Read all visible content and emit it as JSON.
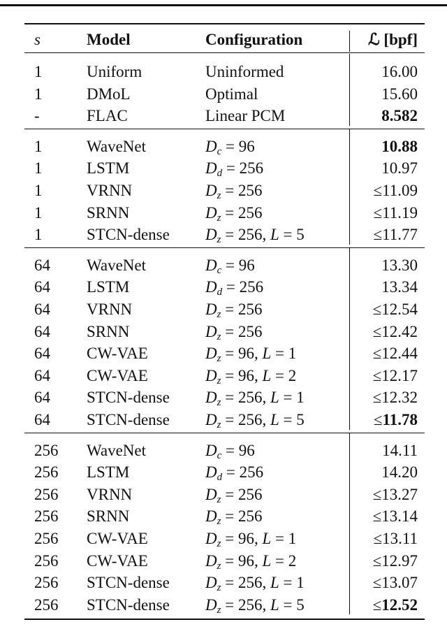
{
  "header": {
    "s": "s",
    "model": "Model",
    "configuration": "Configuration",
    "loss": "ℒ [bpf]"
  },
  "groups": [
    [
      {
        "s": "1",
        "model": "Uniform",
        "config": {
          "text": "Uninformed"
        },
        "value": {
          "prefix": "",
          "number": "16.00",
          "bold": false
        }
      },
      {
        "s": "1",
        "model": "DMoL",
        "config": {
          "text": "Optimal"
        },
        "value": {
          "prefix": "",
          "number": "15.60",
          "bold": false
        }
      },
      {
        "s": "-",
        "model": "FLAC",
        "config": {
          "text": "Linear PCM"
        },
        "value": {
          "prefix": "",
          "number": "8.582",
          "bold": true
        }
      }
    ],
    [
      {
        "s": "1",
        "model": "WaveNet",
        "config": {
          "var": "D",
          "sub": "c",
          "value": "96"
        },
        "value": {
          "prefix": "",
          "number": "10.88",
          "bold": true
        }
      },
      {
        "s": "1",
        "model": "LSTM",
        "config": {
          "var": "D",
          "sub": "d",
          "value": "256"
        },
        "value": {
          "prefix": "",
          "number": "10.97",
          "bold": false
        }
      },
      {
        "s": "1",
        "model": "VRNN",
        "config": {
          "var": "D",
          "sub": "z",
          "value": "256"
        },
        "value": {
          "prefix": "≤",
          "number": "11.09",
          "bold": false
        }
      },
      {
        "s": "1",
        "model": "SRNN",
        "config": {
          "var": "D",
          "sub": "z",
          "value": "256"
        },
        "value": {
          "prefix": "≤",
          "number": "11.19",
          "bold": false
        }
      },
      {
        "s": "1",
        "model": "STCN-dense",
        "config": {
          "var": "D",
          "sub": "z",
          "value": "256",
          "var2": "L",
          "value2": "5"
        },
        "value": {
          "prefix": "≤",
          "number": "11.77",
          "bold": false
        }
      }
    ],
    [
      {
        "s": "64",
        "model": "WaveNet",
        "config": {
          "var": "D",
          "sub": "c",
          "value": "96"
        },
        "value": {
          "prefix": "",
          "number": "13.30",
          "bold": false
        }
      },
      {
        "s": "64",
        "model": "LSTM",
        "config": {
          "var": "D",
          "sub": "d",
          "value": "256"
        },
        "value": {
          "prefix": "",
          "number": "13.34",
          "bold": false
        }
      },
      {
        "s": "64",
        "model": "VRNN",
        "config": {
          "var": "D",
          "sub": "z",
          "value": "256"
        },
        "value": {
          "prefix": "≤",
          "number": "12.54",
          "bold": false
        }
      },
      {
        "s": "64",
        "model": "SRNN",
        "config": {
          "var": "D",
          "sub": "z",
          "value": "256"
        },
        "value": {
          "prefix": "≤",
          "number": "12.42",
          "bold": false
        }
      },
      {
        "s": "64",
        "model": "CW-VAE",
        "config": {
          "var": "D",
          "sub": "z",
          "value": "96",
          "var2": "L",
          "value2": "1"
        },
        "value": {
          "prefix": "≤",
          "number": "12.44",
          "bold": false
        }
      },
      {
        "s": "64",
        "model": "CW-VAE",
        "config": {
          "var": "D",
          "sub": "z",
          "value": "96",
          "var2": "L",
          "value2": "2"
        },
        "value": {
          "prefix": "≤",
          "number": "12.17",
          "bold": false
        }
      },
      {
        "s": "64",
        "model": "STCN-dense",
        "config": {
          "var": "D",
          "sub": "z",
          "value": "256",
          "var2": "L",
          "value2": "1"
        },
        "value": {
          "prefix": "≤",
          "number": "12.32",
          "bold": false
        }
      },
      {
        "s": "64",
        "model": "STCN-dense",
        "config": {
          "var": "D",
          "sub": "z",
          "value": "256",
          "var2": "L",
          "value2": "5"
        },
        "value": {
          "prefix": "≤",
          "number": "11.78",
          "bold": true
        }
      }
    ],
    [
      {
        "s": "256",
        "model": "WaveNet",
        "config": {
          "var": "D",
          "sub": "c",
          "value": "96"
        },
        "value": {
          "prefix": "",
          "number": "14.11",
          "bold": false
        }
      },
      {
        "s": "256",
        "model": "LSTM",
        "config": {
          "var": "D",
          "sub": "d",
          "value": "256"
        },
        "value": {
          "prefix": "",
          "number": "14.20",
          "bold": false
        }
      },
      {
        "s": "256",
        "model": "VRNN",
        "config": {
          "var": "D",
          "sub": "z",
          "value": "256"
        },
        "value": {
          "prefix": "≤",
          "number": "13.27",
          "bold": false
        }
      },
      {
        "s": "256",
        "model": "SRNN",
        "config": {
          "var": "D",
          "sub": "z",
          "value": "256"
        },
        "value": {
          "prefix": "≤",
          "number": "13.14",
          "bold": false
        }
      },
      {
        "s": "256",
        "model": "CW-VAE",
        "config": {
          "var": "D",
          "sub": "z",
          "value": "96",
          "var2": "L",
          "value2": "1"
        },
        "value": {
          "prefix": "≤",
          "number": "13.11",
          "bold": false
        }
      },
      {
        "s": "256",
        "model": "CW-VAE",
        "config": {
          "var": "D",
          "sub": "z",
          "value": "96",
          "var2": "L",
          "value2": "2"
        },
        "value": {
          "prefix": "≤",
          "number": "12.97",
          "bold": false
        }
      },
      {
        "s": "256",
        "model": "STCN-dense",
        "config": {
          "var": "D",
          "sub": "z",
          "value": "256",
          "var2": "L",
          "value2": "1"
        },
        "value": {
          "prefix": "≤",
          "number": "13.07",
          "bold": false
        }
      },
      {
        "s": "256",
        "model": "STCN-dense",
        "config": {
          "var": "D",
          "sub": "z",
          "value": "256",
          "var2": "L",
          "value2": "5"
        },
        "value": {
          "prefix": "≤",
          "number": "12.52",
          "bold": true
        }
      }
    ]
  ]
}
